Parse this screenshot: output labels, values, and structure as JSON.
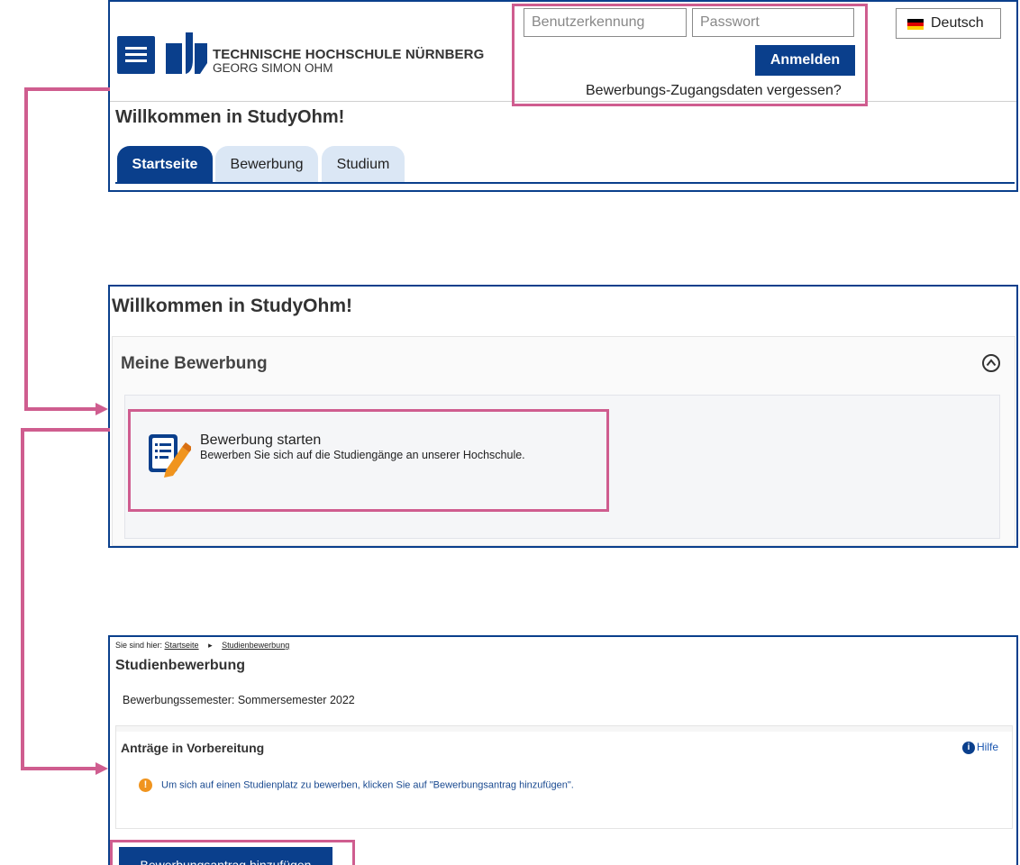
{
  "colors": {
    "primary": "#0a3f8c",
    "highlight": "#cf5d8f",
    "warning": "#f0941e",
    "tab_inactive": "#dbe7f5"
  },
  "header": {
    "menu_icon": "hamburger-icon",
    "logo_line1": "TECHNISCHE HOCHSCHULE NÜRNBERG",
    "logo_line2": "GEORG SIMON OHM",
    "username_placeholder": "Benutzerkennung",
    "password_placeholder": "Passwort",
    "login_label": "Anmelden",
    "forgot_label": "Bewerbungs-Zugangsdaten vergessen?",
    "language_label": "Deutsch"
  },
  "start_page": {
    "welcome": "Willkommen in StudyOhm!",
    "tabs": [
      {
        "label": "Startseite",
        "active": true
      },
      {
        "label": "Bewerbung",
        "active": false
      },
      {
        "label": "Studium",
        "active": false
      }
    ]
  },
  "application_page": {
    "welcome": "Willkommen in StudyOhm!",
    "section_title": "Meine Bewerbung",
    "start_title": "Bewerbung starten",
    "start_description": "Bewerben Sie sich auf die Studiengänge an unserer Hochschule."
  },
  "study_application": {
    "breadcrumb_prefix": "Sie sind hier:",
    "breadcrumb_home": "Startseite",
    "breadcrumb_current": "Studienbewerbung",
    "title": "Studienbewerbung",
    "semester": "Bewerbungssemester: Sommersemester 2022",
    "section_title": "Anträge in Vorbereitung",
    "help_label": "Hilfe",
    "info_text": "Um sich auf einen Studienplatz zu bewerben, klicken Sie auf \"Bewerbungsantrag hinzufügen\".",
    "add_button_label": "Bewerbungsantrag hinzufügen"
  }
}
